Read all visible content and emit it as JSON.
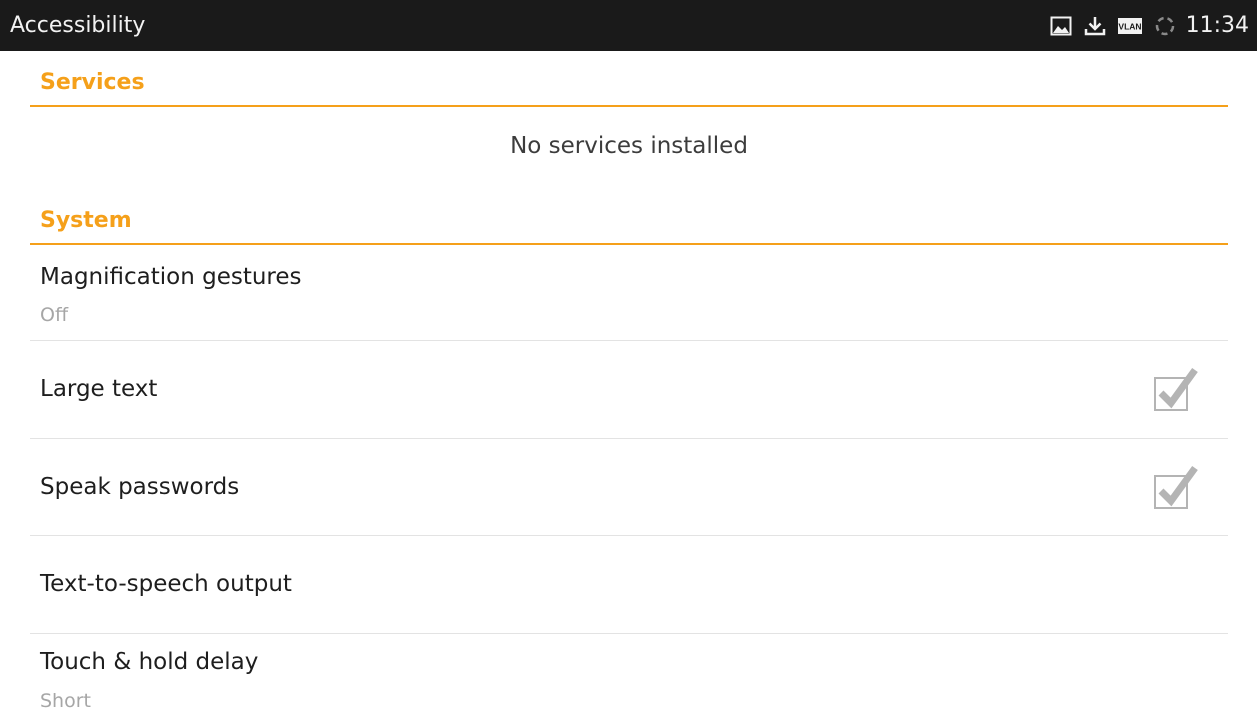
{
  "status_bar": {
    "title": "Accessibility",
    "time": "11:34",
    "icons": [
      "image-icon",
      "download-icon",
      "vlan-icon",
      "sync-spinner-icon"
    ],
    "vlan_label": "VLAN"
  },
  "colors": {
    "accent": "#f5a01a",
    "status_bar_bg": "#1a1a1a",
    "divider": "#e3e3e3",
    "summary_text": "#a6a6a6",
    "checkbox_gray": "#b4b4b4"
  },
  "sections": {
    "services": {
      "header": "Services",
      "empty_message": "No services installed"
    },
    "system": {
      "header": "System",
      "items": [
        {
          "title": "Magnification gestures",
          "summary": "Off"
        },
        {
          "title": "Large text",
          "checked": true
        },
        {
          "title": "Speak passwords",
          "checked": true
        },
        {
          "title": "Text-to-speech output"
        },
        {
          "title": "Touch & hold delay",
          "summary": "Short"
        }
      ]
    }
  }
}
